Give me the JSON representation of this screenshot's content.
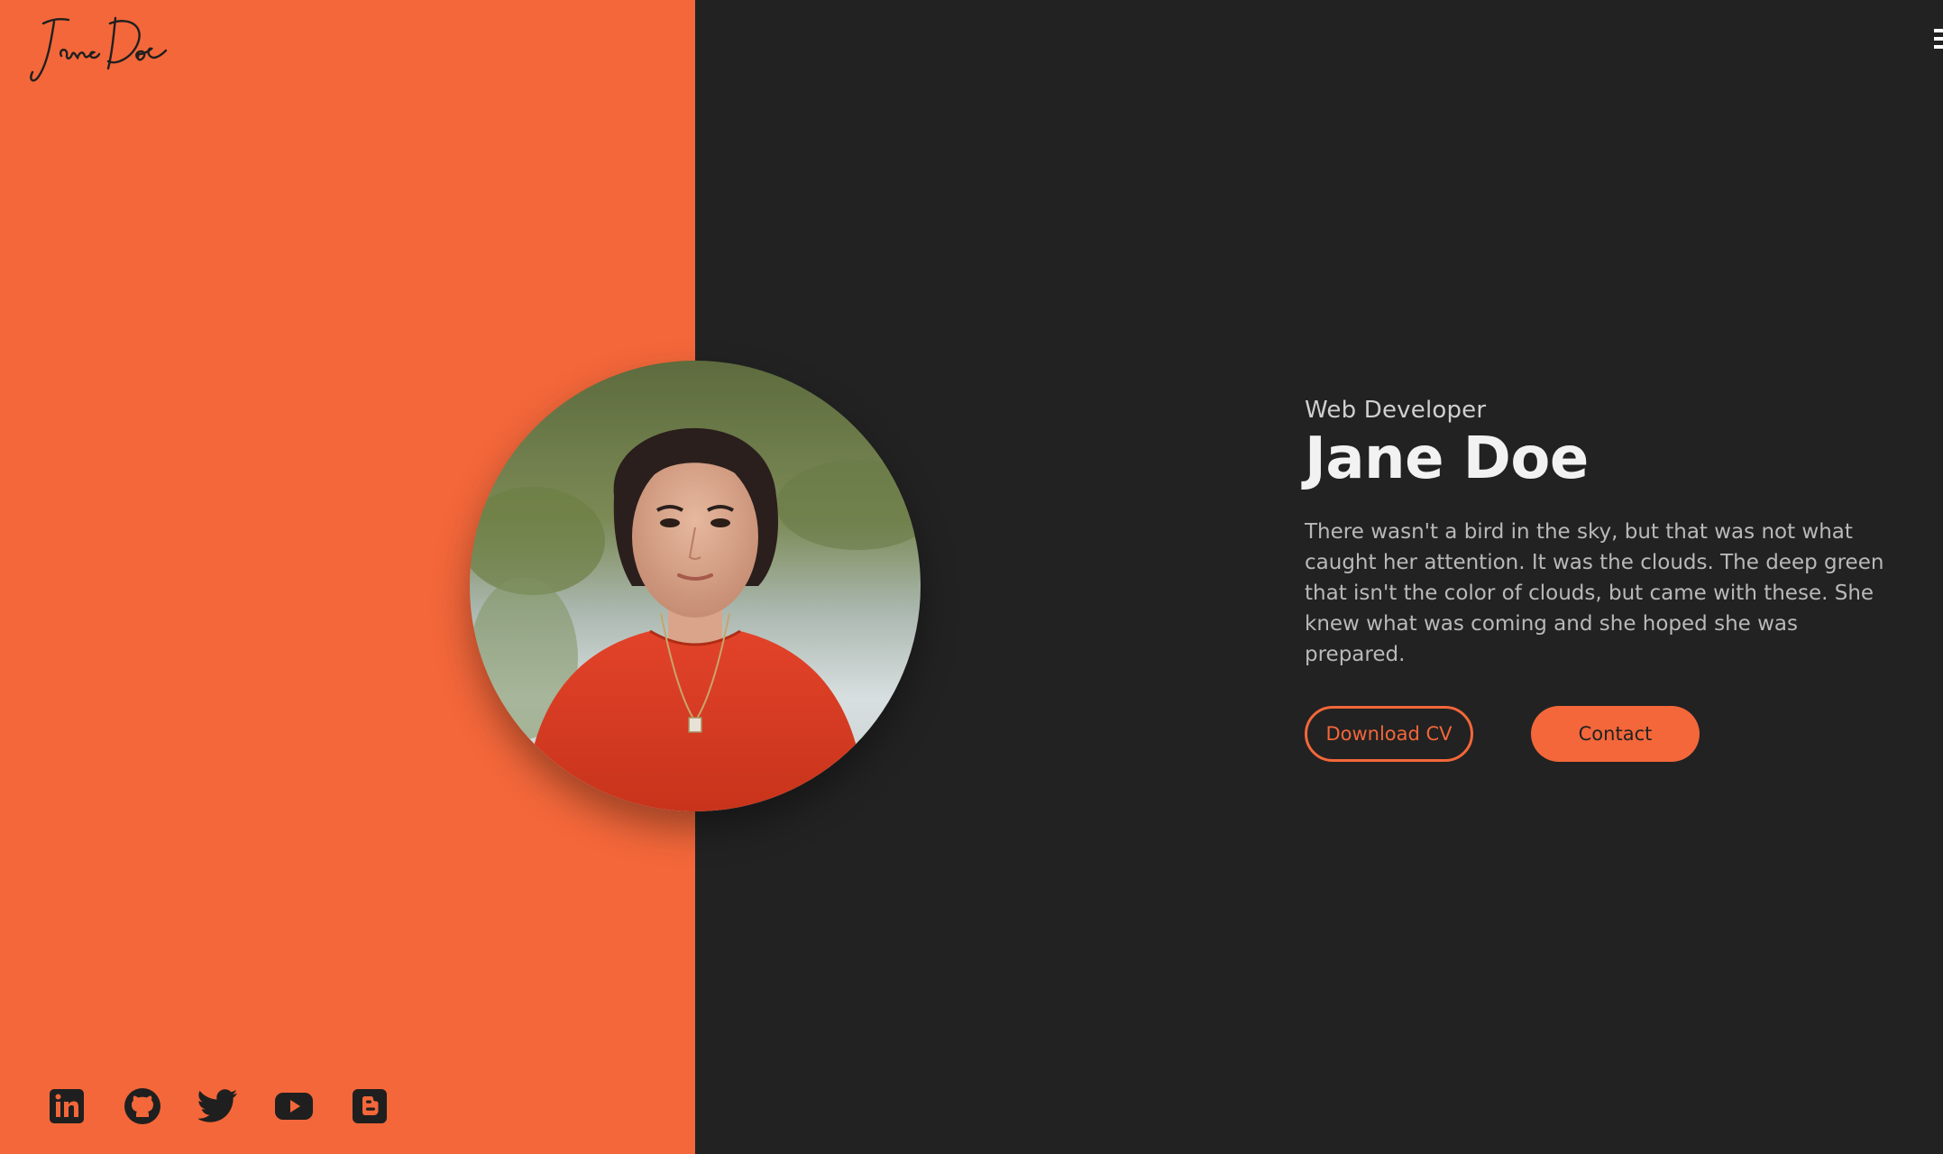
{
  "logo": {
    "text": "Jane Doe"
  },
  "hero": {
    "role": "Web Developer",
    "name": "Jane Doe",
    "bio": "There wasn't a bird in the sky, but that was not what caught her attention. It was the clouds. The deep green that isn't the color of clouds, but came with these. She knew what was coming and she hoped she was prepared."
  },
  "buttons": {
    "download_cv": "Download CV",
    "contact": "Contact"
  },
  "socials": [
    {
      "icon": "linkedin-icon"
    },
    {
      "icon": "github-icon"
    },
    {
      "icon": "twitter-icon"
    },
    {
      "icon": "youtube-icon"
    },
    {
      "icon": "blogger-icon"
    }
  ],
  "colors": {
    "accent": "#f3673a",
    "dark": "#222222",
    "text_light": "#f2f2f2",
    "text_muted": "#b9b9b9"
  }
}
